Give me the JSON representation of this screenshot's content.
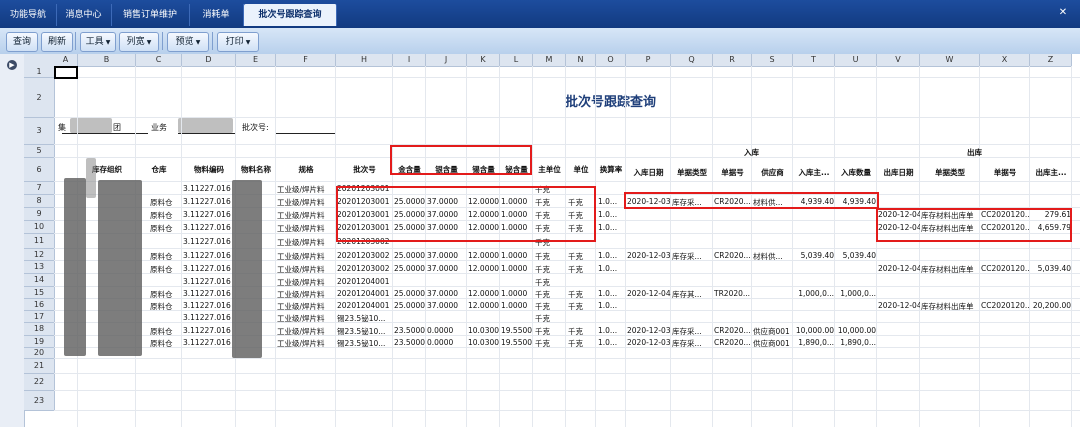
{
  "tabs": [
    "功能导航",
    "消息中心",
    "销售订单维护",
    "消耗单",
    "批次号跟踪查询"
  ],
  "toolbar": {
    "query": "查询",
    "refresh": "刷新",
    "tools": "工具",
    "layout": "列宽",
    "preview": "预览",
    "print": "打印"
  },
  "columns": [
    "A",
    "B",
    "C",
    "D",
    "E",
    "F",
    "H",
    "I",
    "J",
    "K",
    "L",
    "M",
    "N",
    "O",
    "P",
    "Q",
    "R",
    "S",
    "T",
    "U",
    "V",
    "W",
    "X",
    "Z"
  ],
  "rows": [
    "1",
    "2",
    "3",
    "5",
    "6",
    "7",
    "8",
    "9",
    "10",
    "11",
    "12",
    "13",
    "14",
    "15",
    "16",
    "17",
    "18",
    "19",
    "20",
    "21",
    "22",
    "23"
  ],
  "report": {
    "title": "批次号跟踪查询",
    "filter_group_prefix": "集",
    "filter_group_suffix": "团",
    "filter_business_label": "业务",
    "filter_batch_label": "批次号:"
  },
  "headers": {
    "org": "库存组织",
    "warehouse": "仓库",
    "material_code": "物料编码",
    "material_name": "物料名称",
    "spec": "规格",
    "batch": "批次号",
    "gold": "金含量",
    "silver": "银含量",
    "tin": "锡含量",
    "bismuth": "铋含量",
    "main_unit": "主单位",
    "unit": "单位",
    "conv": "换算率",
    "in_group": "入库",
    "in_date": "入库日期",
    "in_type": "单据类型",
    "in_no": "单据号",
    "supplier": "供应商",
    "in_main": "入库主...",
    "in_qty": "入库数量",
    "out_group": "出库",
    "out_date": "出库日期",
    "out_type": "单据类型",
    "out_no": "单据号",
    "out_main": "出库主..."
  },
  "table_rows": [
    {
      "row": "7",
      "wh": "",
      "code": "3.11227.016",
      "spec": "工业级/焊片料",
      "batch": "20201203001",
      "gold": "",
      "silver": "",
      "tin": "",
      "bi": "",
      "mu": "千克",
      "unit": "",
      "conv": "",
      "in_date": "",
      "in_type": "",
      "in_no": "",
      "supplier": "",
      "in_main": "",
      "in_qty": "",
      "out_date": "",
      "out_type": "",
      "out_no": "",
      "out_main": ""
    },
    {
      "row": "8",
      "wh": "原料仓",
      "code": "3.11227.016",
      "spec": "工业级/焊片料",
      "batch": "20201203001",
      "gold": "25.0000",
      "silver": "37.0000",
      "tin": "12.0000",
      "bi": "1.0000",
      "mu": "千克",
      "unit": "千克",
      "conv": "1.0...",
      "in_date": "2020-12-03",
      "in_type": "库存采...",
      "in_no": "CR2020...",
      "supplier": "材料供...",
      "in_main": "4,939.40",
      "in_qty": "4,939.40",
      "out_date": "",
      "out_type": "",
      "out_no": "",
      "out_main": ""
    },
    {
      "row": "9",
      "wh": "原料仓",
      "code": "3.11227.016",
      "spec": "工业级/焊片料",
      "batch": "20201203001",
      "gold": "25.0000",
      "silver": "37.0000",
      "tin": "12.0000",
      "bi": "1.0000",
      "mu": "千克",
      "unit": "千克",
      "conv": "1.0...",
      "in_date": "",
      "in_type": "",
      "in_no": "",
      "supplier": "",
      "in_main": "",
      "in_qty": "",
      "out_date": "2020-12-04",
      "out_type": "库存材料出库单",
      "out_no": "CC2020120...",
      "out_main": "279.61"
    },
    {
      "row": "10",
      "wh": "原料仓",
      "code": "3.11227.016",
      "spec": "工业级/焊片料",
      "batch": "20201203001",
      "gold": "25.0000",
      "silver": "37.0000",
      "tin": "12.0000",
      "bi": "1.0000",
      "mu": "千克",
      "unit": "千克",
      "conv": "1.0...",
      "in_date": "",
      "in_type": "",
      "in_no": "",
      "supplier": "",
      "in_main": "",
      "in_qty": "",
      "out_date": "2020-12-04",
      "out_type": "库存材料出库单",
      "out_no": "CC2020120...",
      "out_main": "4,659.79"
    },
    {
      "row": "11",
      "wh": "",
      "code": "3.11227.016",
      "spec": "工业级/焊片料",
      "batch": "20201203002",
      "gold": "",
      "silver": "",
      "tin": "",
      "bi": "",
      "mu": "千克",
      "unit": "",
      "conv": "",
      "in_date": "",
      "in_type": "",
      "in_no": "",
      "supplier": "",
      "in_main": "",
      "in_qty": "",
      "out_date": "",
      "out_type": "",
      "out_no": "",
      "out_main": ""
    },
    {
      "row": "12",
      "wh": "原料仓",
      "code": "3.11227.016",
      "spec": "工业级/焊片料",
      "batch": "20201203002",
      "gold": "25.0000",
      "silver": "37.0000",
      "tin": "12.0000",
      "bi": "1.0000",
      "mu": "千克",
      "unit": "千克",
      "conv": "1.0...",
      "in_date": "2020-12-03",
      "in_type": "库存采...",
      "in_no": "CR2020...",
      "supplier": "材料供...",
      "in_main": "5,039.40",
      "in_qty": "5,039.40",
      "out_date": "",
      "out_type": "",
      "out_no": "",
      "out_main": ""
    },
    {
      "row": "13",
      "wh": "原料仓",
      "code": "3.11227.016",
      "spec": "工业级/焊片料",
      "batch": "20201203002",
      "gold": "25.0000",
      "silver": "37.0000",
      "tin": "12.0000",
      "bi": "1.0000",
      "mu": "千克",
      "unit": "千克",
      "conv": "1.0...",
      "in_date": "",
      "in_type": "",
      "in_no": "",
      "supplier": "",
      "in_main": "",
      "in_qty": "",
      "out_date": "2020-12-04",
      "out_type": "库存材料出库单",
      "out_no": "CC2020120...",
      "out_main": "5,039.40"
    },
    {
      "row": "14",
      "wh": "",
      "code": "3.11227.016",
      "spec": "工业级/焊片料",
      "batch": "20201204001",
      "gold": "",
      "silver": "",
      "tin": "",
      "bi": "",
      "mu": "千克",
      "unit": "",
      "conv": "",
      "in_date": "",
      "in_type": "",
      "in_no": "",
      "supplier": "",
      "in_main": "",
      "in_qty": "",
      "out_date": "",
      "out_type": "",
      "out_no": "",
      "out_main": ""
    },
    {
      "row": "15",
      "wh": "原料仓",
      "code": "3.11227.016",
      "spec": "工业级/焊片料",
      "batch": "20201204001",
      "gold": "25.0000",
      "silver": "37.0000",
      "tin": "12.0000",
      "bi": "1.0000",
      "mu": "千克",
      "unit": "千克",
      "conv": "1.0...",
      "in_date": "2020-12-04",
      "in_type": "库存其...",
      "in_no": "TR2020...",
      "supplier": "",
      "in_main": "1,000,0...",
      "in_qty": "1,000,0...",
      "out_date": "",
      "out_type": "",
      "out_no": "",
      "out_main": ""
    },
    {
      "row": "16",
      "wh": "原料仓",
      "code": "3.11227.016",
      "spec": "工业级/焊片料",
      "batch": "20201204001",
      "gold": "25.0000",
      "silver": "37.0000",
      "tin": "12.0000",
      "bi": "1.0000",
      "mu": "千克",
      "unit": "千克",
      "conv": "1.0...",
      "in_date": "",
      "in_type": "",
      "in_no": "",
      "supplier": "",
      "in_main": "",
      "in_qty": "",
      "out_date": "2020-12-04",
      "out_type": "库存材料出库单",
      "out_no": "CC2020120...",
      "out_main": "20,200.00"
    },
    {
      "row": "17",
      "wh": "",
      "code": "3.11227.016",
      "spec": "工业级/焊片料",
      "batch": "锡23.5铋10...",
      "gold": "",
      "silver": "",
      "tin": "",
      "bi": "",
      "mu": "千克",
      "unit": "",
      "conv": "",
      "in_date": "",
      "in_type": "",
      "in_no": "",
      "supplier": "",
      "in_main": "",
      "in_qty": "",
      "out_date": "",
      "out_type": "",
      "out_no": "",
      "out_main": ""
    },
    {
      "row": "18",
      "wh": "原料仓",
      "code": "3.11227.016",
      "spec": "工业级/焊片料",
      "batch": "锡23.5铋10...",
      "gold": "23.5000",
      "silver": "0.0000",
      "tin": "10.0300",
      "bi": "19.5500",
      "mu": "千克",
      "unit": "千克",
      "conv": "1.0...",
      "in_date": "2020-12-03",
      "in_type": "库存采...",
      "in_no": "CR2020...",
      "supplier": "供应商001",
      "in_main": "10,000.00",
      "in_qty": "10,000.00",
      "out_date": "",
      "out_type": "",
      "out_no": "",
      "out_main": ""
    },
    {
      "row": "19",
      "wh": "原料仓",
      "code": "3.11227.016",
      "spec": "工业级/焊片料",
      "batch": "锡23.5铋10...",
      "gold": "23.5000",
      "silver": "0.0000",
      "tin": "10.0300",
      "bi": "19.5500",
      "mu": "千克",
      "unit": "千克",
      "conv": "1.0...",
      "in_date": "2020-12-03",
      "in_type": "库存采...",
      "in_no": "CR2020...",
      "supplier": "供应商001",
      "in_main": "1,890,0...",
      "in_qty": "1,890,0...",
      "out_date": "",
      "out_type": "",
      "out_no": "",
      "out_main": ""
    }
  ],
  "colors": {
    "tabbar": "#1d4d9e",
    "highlight": "#e31b1b",
    "title": "#1f3f7a"
  },
  "icons": {
    "close": "close-icon",
    "expand": "expand-icon"
  }
}
